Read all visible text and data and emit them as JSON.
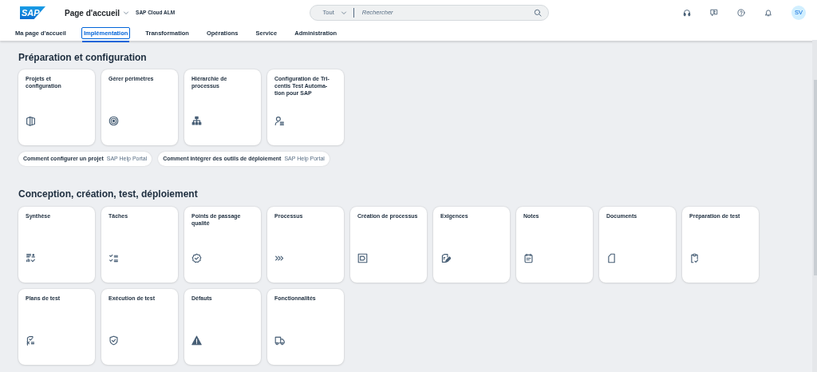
{
  "header": {
    "logo": "SAP",
    "title": "Page d'accueil",
    "subtitle": "SAP Cloud ALM",
    "search": {
      "scope": "Tout",
      "placeholder": "Rechercher"
    },
    "avatar": "SV"
  },
  "tabs": [
    {
      "label": "Ma page d'accueil",
      "selected": false
    },
    {
      "label": "Implémentation",
      "selected": true
    },
    {
      "label": "Transformation",
      "selected": false
    },
    {
      "label": "Opérations",
      "selected": false
    },
    {
      "label": "Service",
      "selected": false
    },
    {
      "label": "Administration",
      "selected": false
    }
  ],
  "sections": [
    {
      "title": "Préparation et configuration",
      "tiles": [
        {
          "title": "Projets et configuration"
        },
        {
          "title": "Gérer périmètres"
        },
        {
          "title": "Hiérarchie de processus"
        },
        {
          "title": "Configuration de Tri-centis Test Automa-tion pour SAP"
        }
      ],
      "links": [
        {
          "text": "Comment configurer un projet",
          "source": "SAP Help Portal"
        },
        {
          "text": "Comment intégrer des outils de déploiement",
          "source": "SAP Help Portal"
        }
      ]
    },
    {
      "title": "Conception, création, test, déploiement",
      "tiles": [
        {
          "title": "Synthèse"
        },
        {
          "title": "Tâches"
        },
        {
          "title": "Points de passage qualité"
        },
        {
          "title": "Processus"
        },
        {
          "title": "Création de processus"
        },
        {
          "title": "Exigences"
        },
        {
          "title": "Notes"
        },
        {
          "title": "Documents"
        },
        {
          "title": "Préparation de test"
        },
        {
          "title": "Plans de test"
        },
        {
          "title": "Exécution de test"
        },
        {
          "title": "Défauts"
        },
        {
          "title": "Fonctionnalités"
        }
      ]
    }
  ]
}
